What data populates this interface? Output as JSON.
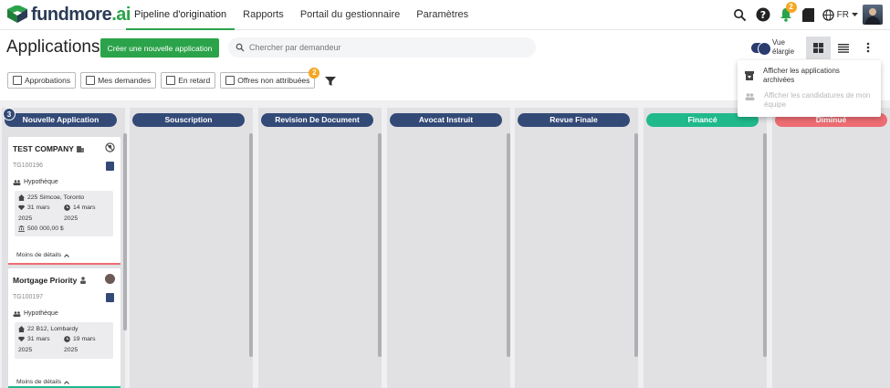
{
  "brand": {
    "name_main": "fundmore",
    "name_suffix": ".ai"
  },
  "nav": {
    "links": [
      "Pipeline d'origination",
      "Rapports",
      "Portail du gestionnaire",
      "Paramètres"
    ],
    "notifications_count": "2",
    "language": "FR"
  },
  "header": {
    "title": "Applications",
    "create_button": "Créer une nouvelle application",
    "search_placeholder": "Chercher par demandeur",
    "toggle_label": "Vue élargie"
  },
  "filters": {
    "items": [
      "Approbations",
      "Mes demandes",
      "En retard",
      "Offres non attribuées"
    ],
    "unassigned_count": "2"
  },
  "columns": [
    {
      "label": "Nouvelle Application",
      "count": "3",
      "color": "#334a77"
    },
    {
      "label": "Souscription",
      "color": "#334a77"
    },
    {
      "label": "Revision De Document",
      "color": "#334a77"
    },
    {
      "label": "Avocat Instruit",
      "color": "#334a77"
    },
    {
      "label": "Revue Finale",
      "color": "#334a77"
    },
    {
      "label": "Financé",
      "color": "#20b98c"
    },
    {
      "label": "Diminué",
      "color": "#ed6d72"
    }
  ],
  "cards": [
    {
      "title": "TEST COMPANY",
      "ref": "TG100196",
      "type": "Hypothèque",
      "address": "225 Simcoe, Toronto",
      "date1_a": "31 mars",
      "date1_b": "2025",
      "date2_a": "14 mars",
      "date2_b": "2025",
      "amount": "500 000,00 $",
      "less": "Moins de détails",
      "bar_color": "#ed6d72"
    },
    {
      "title": "Mortgage Priority",
      "ref": "TG100197",
      "type": "Hypothèque",
      "address": "22 B12, Lombardy",
      "date1_a": "31 mars",
      "date1_b": "2025",
      "date2_a": "19 mars",
      "date2_b": "2025",
      "less": "Moins de détails",
      "bar_color": "#20b98c"
    }
  ],
  "dropdown": {
    "items": [
      "Afficher les applications archivées",
      "Afficher les candidatures de mon équipe"
    ]
  },
  "colors": {
    "accent": "#2ba34a",
    "primary": "#334a77",
    "funded": "#20b98c",
    "declined": "#ed6d72",
    "badge": "#f5a623"
  }
}
